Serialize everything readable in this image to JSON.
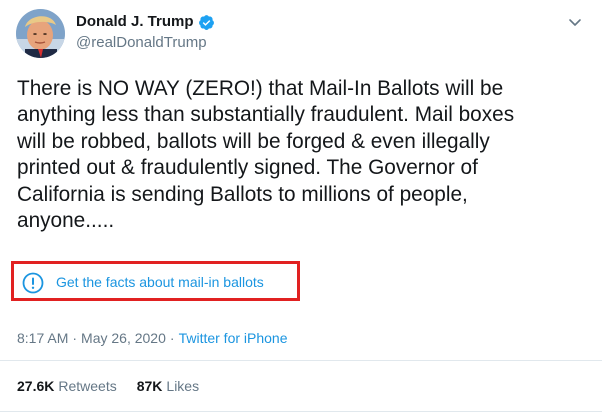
{
  "author": {
    "display_name": "Donald J. Trump",
    "handle": "@realDonaldTrump",
    "verified": true,
    "avatar_icon": "profile-photo"
  },
  "tweet": {
    "text": "There is NO WAY (ZERO!) that Mail-In Ballots will be\nanything less than substantially fraudulent. Mail boxes\nwill be robbed, ballots will be forged & even illegally\nprinted out & fraudulently signed. The Governor of\nCalifornia is sending Ballots to millions of people,\nanyone....."
  },
  "fact_check": {
    "label": "Get the facts about mail-in ballots",
    "icon": "exclamation-circle-icon",
    "highlight_color": "#e12121"
  },
  "meta": {
    "time": "8:17 AM",
    "separator1": "·",
    "date": "May 26, 2020",
    "separator2": "·",
    "source": "Twitter for iPhone"
  },
  "stats": {
    "retweets_count": "27.6K",
    "retweets_label": "Retweets",
    "likes_count": "87K",
    "likes_label": "Likes"
  },
  "colors": {
    "link": "#1b95e0",
    "muted": "#657786",
    "text": "#14171a",
    "verified": "#1da1f2"
  }
}
